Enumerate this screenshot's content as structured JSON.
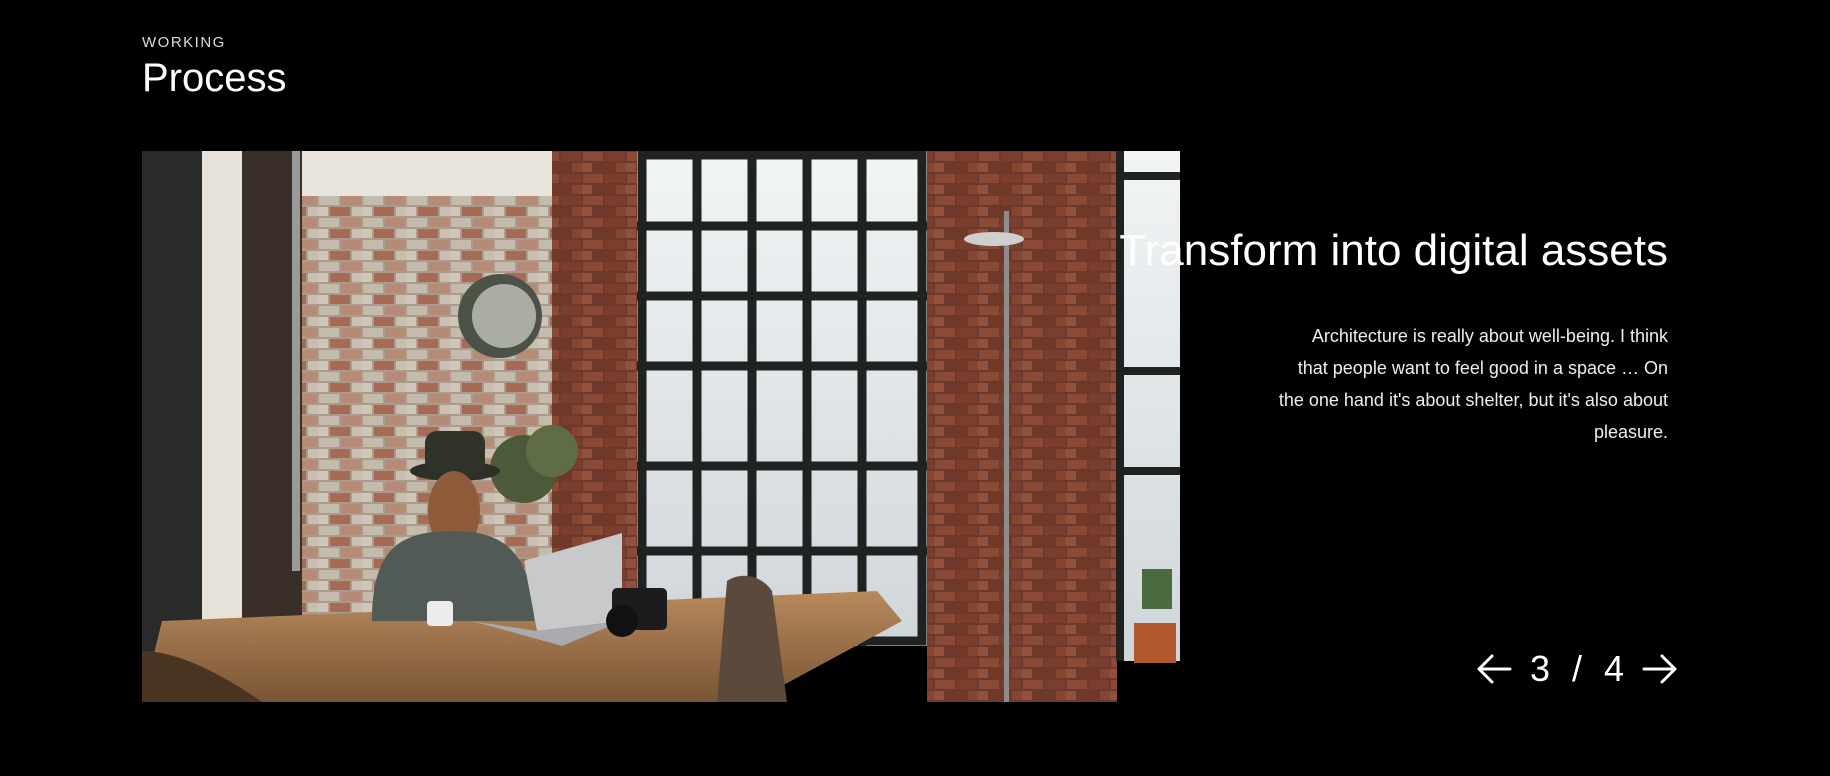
{
  "section": {
    "eyebrow": "WORKING",
    "title": "Process"
  },
  "slide": {
    "title": "Transform into digital assets",
    "text": "Architecture is really about well-being. I think that people want to feel good in a space … On the one hand it's about shelter, but it's also about pleasure.",
    "image_alt": "Man with hat working on a laptop at a wooden table in a brick loft with large windows"
  },
  "pager": {
    "current": "3",
    "separator": "/",
    "total": "4",
    "prev_icon": "arrow-left-icon",
    "next_icon": "arrow-right-icon"
  },
  "colors": {
    "background": "#000000",
    "text": "#ffffff"
  }
}
